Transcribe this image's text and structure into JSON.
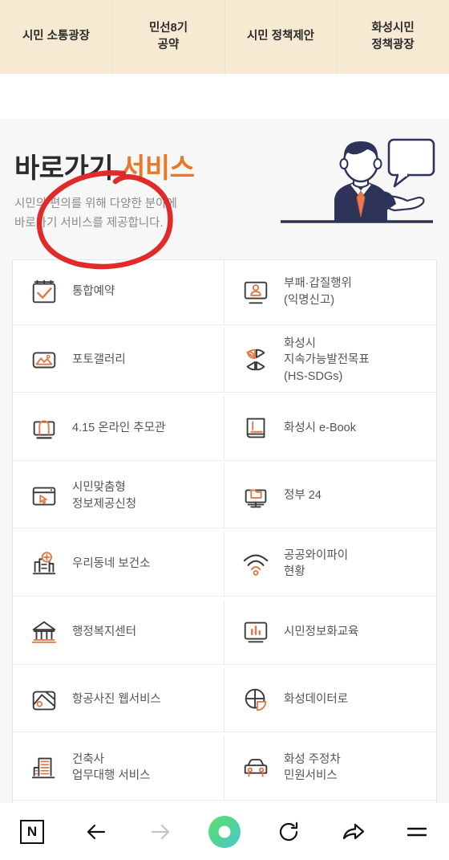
{
  "topnav": {
    "tabs": [
      {
        "label": "시민 소통광장",
        "name": "tab-citizen-communication"
      },
      {
        "label": "민선8기\n공약",
        "name": "tab-pledge"
      },
      {
        "label": "시민 정책제안",
        "name": "tab-policy-proposal"
      },
      {
        "label": "화성시민\n정책광장",
        "name": "tab-hwaseong-policy-plaza"
      }
    ]
  },
  "hero": {
    "title_dark": "바로가기",
    "title_accent": "서비스",
    "subtitle": "시민의 편의를 위해 다양한 분야에\n바로가기 서비스를 제공합니다.",
    "illustration": "businessman-speech-bubble-illustration"
  },
  "colors": {
    "accent_orange": "#e8792a",
    "icon_orange": "#e07a4a",
    "icon_dark": "#3a3a3a",
    "nav_beige": "#f7ead2",
    "page_bg": "#f7f7f7",
    "text_grey": "#555555",
    "subtitle_grey": "#8b8b8b",
    "annotation_red": "#e02b2b",
    "browser_green": "#5ddd70",
    "browser_teal": "#4fc8d8"
  },
  "services": [
    {
      "label": "통합예약",
      "icon": "calendar-check-icon"
    },
    {
      "label": "부패·갑질행위\n(익명신고)",
      "icon": "anonymous-report-monitor-icon"
    },
    {
      "label": "포토갤러리",
      "icon": "photo-gallery-icon"
    },
    {
      "label": "화성시\n지속가능발전목표\n(HS-SDGs)",
      "icon": "sdg-petal-circle-icon"
    },
    {
      "label": "4.15 온라인 추모관",
      "icon": "memorial-hall-icon"
    },
    {
      "label": "화성시 e-Book",
      "icon": "ebook-icon"
    },
    {
      "label": "시민맞춤형\n정보제공신청",
      "icon": "browser-cursor-icon"
    },
    {
      "label": "정부 24",
      "icon": "government-monitor-folder-icon"
    },
    {
      "label": "우리동네 보건소",
      "icon": "health-center-icon"
    },
    {
      "label": "공공와이파이\n현황",
      "icon": "wifi-icon"
    },
    {
      "label": "행정복지센터",
      "icon": "government-building-icon"
    },
    {
      "label": "시민정보화교육",
      "icon": "bar-chart-monitor-icon"
    },
    {
      "label": "항공사진 웹서비스",
      "icon": "aerial-photo-map-icon"
    },
    {
      "label": "화성데이터로",
      "icon": "pie-chart-data-icon"
    },
    {
      "label": "건축사\n업무대행 서비스",
      "icon": "building-office-icon"
    },
    {
      "label": "화성 주정차\n민원서비스",
      "icon": "car-parking-icon"
    }
  ],
  "annotation": {
    "type": "hand-drawn-red-circle",
    "target_label": "포토갤러리"
  },
  "browserbar": {
    "items": [
      {
        "label": "N",
        "name": "naver-home-button",
        "icon": "naver-n-icon"
      },
      {
        "label": "",
        "name": "back-button",
        "icon": "arrow-left-icon"
      },
      {
        "label": "",
        "name": "forward-button",
        "icon": "arrow-right-icon"
      },
      {
        "label": "",
        "name": "naver-search-button",
        "icon": "green-ring-icon"
      },
      {
        "label": "",
        "name": "reload-button",
        "icon": "reload-icon"
      },
      {
        "label": "",
        "name": "share-button",
        "icon": "share-arrow-icon"
      },
      {
        "label": "",
        "name": "menu-button",
        "icon": "hamburger-menu-icon"
      }
    ]
  }
}
